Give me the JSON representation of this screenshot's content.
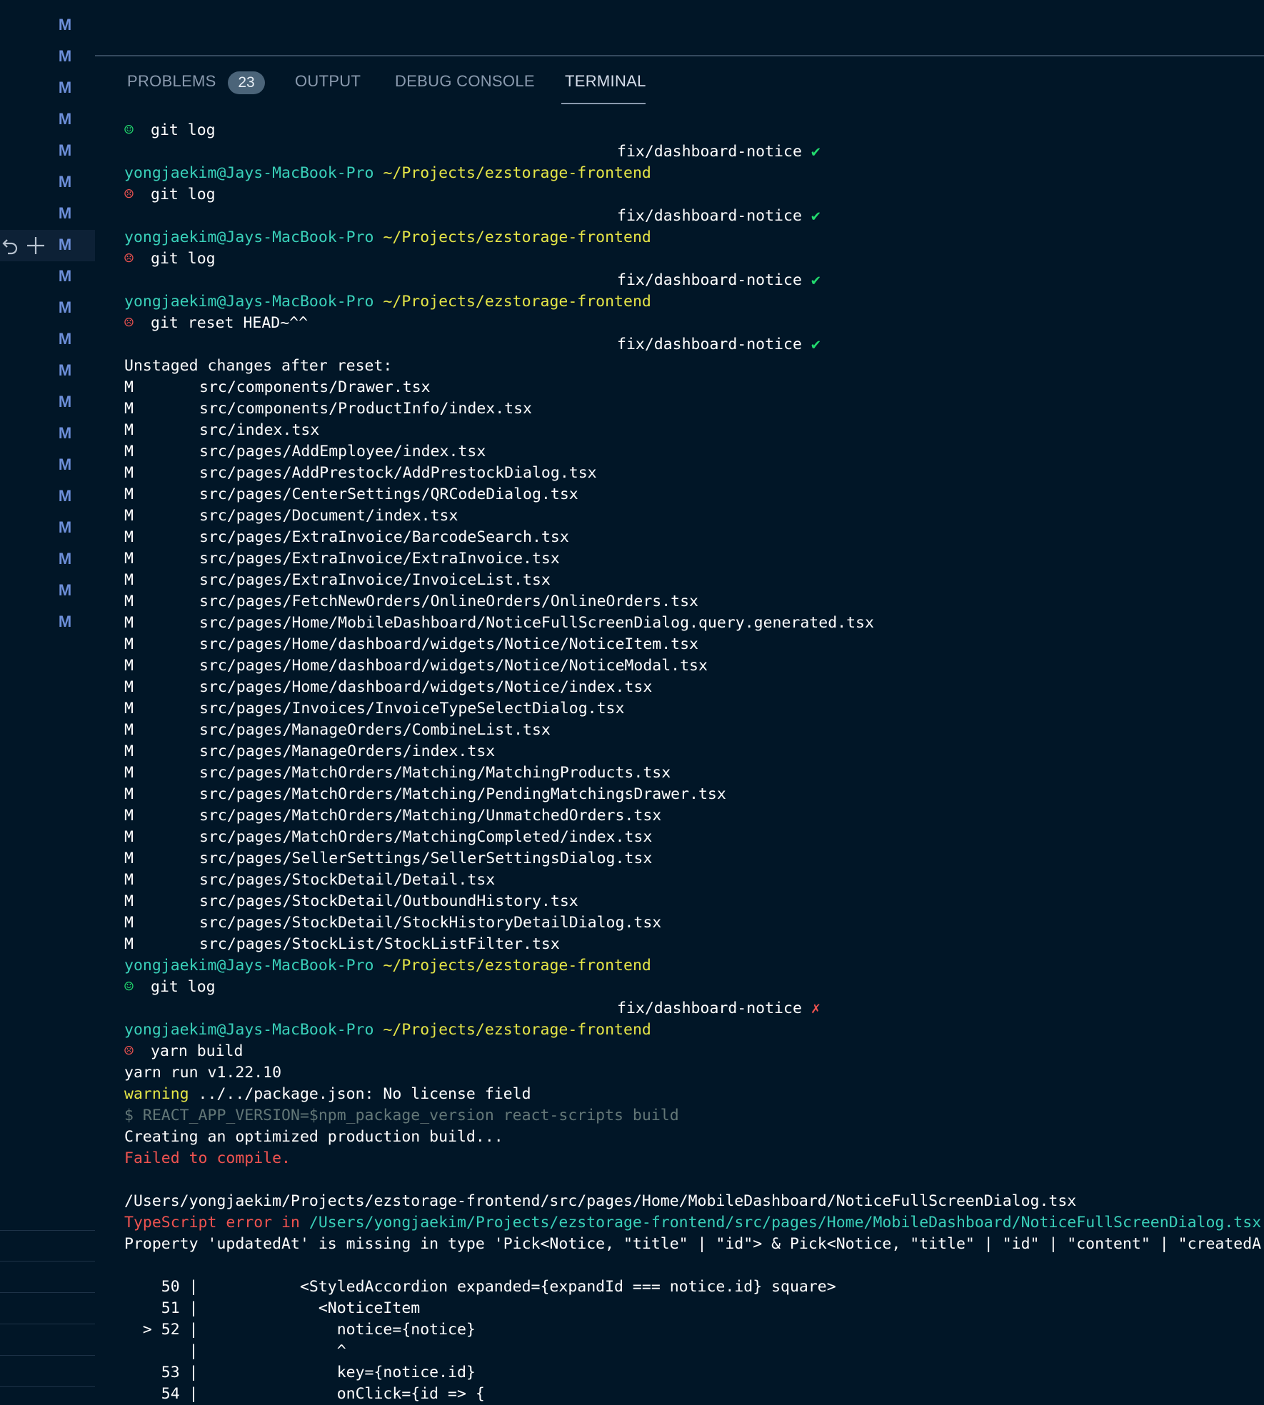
{
  "gutter": {
    "marks": [
      "M",
      "M",
      "M",
      "M",
      "M",
      "M",
      "M",
      "M",
      "M",
      "M",
      "M",
      "M",
      "M",
      "M",
      "M",
      "M",
      "M",
      "M",
      "M",
      "M"
    ]
  },
  "panel": {
    "tabs": [
      {
        "label": "PROBLEMS",
        "badge": "23"
      },
      {
        "label": "OUTPUT"
      },
      {
        "label": "DEBUG CONSOLE"
      },
      {
        "label": "TERMINAL",
        "active": true
      }
    ]
  },
  "terminal": {
    "user": "yongjaekim@Jays-MacBook-Pro",
    "path": "~/Projects/ezstorage-frontend",
    "branch": "fix/dashboard-notice",
    "check": "✔",
    "cross": "✗",
    "happy": "☺",
    "sad": "☹",
    "cmd_git_log": "git log",
    "cmd_reset": "git reset HEAD~^^",
    "unstaged_header": "Unstaged changes after reset:",
    "status_letter": "M",
    "modified_files": [
      "src/components/Drawer.tsx",
      "src/components/ProductInfo/index.tsx",
      "src/index.tsx",
      "src/pages/AddEmployee/index.tsx",
      "src/pages/AddPrestock/AddPrestockDialog.tsx",
      "src/pages/CenterSettings/QRCodeDialog.tsx",
      "src/pages/Document/index.tsx",
      "src/pages/ExtraInvoice/BarcodeSearch.tsx",
      "src/pages/ExtraInvoice/ExtraInvoice.tsx",
      "src/pages/ExtraInvoice/InvoiceList.tsx",
      "src/pages/FetchNewOrders/OnlineOrders/OnlineOrders.tsx",
      "src/pages/Home/MobileDashboard/NoticeFullScreenDialog.query.generated.tsx",
      "src/pages/Home/dashboard/widgets/Notice/NoticeItem.tsx",
      "src/pages/Home/dashboard/widgets/Notice/NoticeModal.tsx",
      "src/pages/Home/dashboard/widgets/Notice/index.tsx",
      "src/pages/Invoices/InvoiceTypeSelectDialog.tsx",
      "src/pages/ManageOrders/CombineList.tsx",
      "src/pages/ManageOrders/index.tsx",
      "src/pages/MatchOrders/Matching/MatchingProducts.tsx",
      "src/pages/MatchOrders/Matching/PendingMatchingsDrawer.tsx",
      "src/pages/MatchOrders/Matching/UnmatchedOrders.tsx",
      "src/pages/MatchOrders/MatchingCompleted/index.tsx",
      "src/pages/SellerSettings/SellerSettingsDialog.tsx",
      "src/pages/StockDetail/Detail.tsx",
      "src/pages/StockDetail/OutboundHistory.tsx",
      "src/pages/StockDetail/StockHistoryDetailDialog.tsx",
      "src/pages/StockList/StockListFilter.tsx"
    ],
    "cmd_yarn": "yarn build",
    "yarn_version": "yarn run v1.22.10",
    "warning_label": "warning",
    "warning_text": " ../../package.json: No license field",
    "script_line": "$ REACT_APP_VERSION=$npm_package_version react-scripts build",
    "creating": "Creating an optimized production build...",
    "failed": "Failed to compile.",
    "error_file": "/Users/yongjaekim/Projects/ezstorage-frontend/src/pages/Home/MobileDashboard/NoticeFullScreenDialog.tsx",
    "ts_error_prefix": "TypeScript error in ",
    "ts_error_path": "/Users/yongjaekim/Projects/ezstorage-frontend/src/pages/Home/MobileDashboard/NoticeFullScreenDialog.tsx",
    "property_error": "Property 'updatedAt' is missing in type 'Pick<Notice, \"title\" | \"id\"> & Pick<Notice, \"title\" | \"id\" | \"content\" | \"createdA",
    "code_lines": [
      "    50 |           <StyledAccordion expanded={expandId === notice.id} square>",
      "    51 |             <NoticeItem",
      "  > 52 |               notice={notice}",
      "       |               ^",
      "    53 |               key={notice.id}",
      "    54 |               onClick={id => {"
    ]
  }
}
